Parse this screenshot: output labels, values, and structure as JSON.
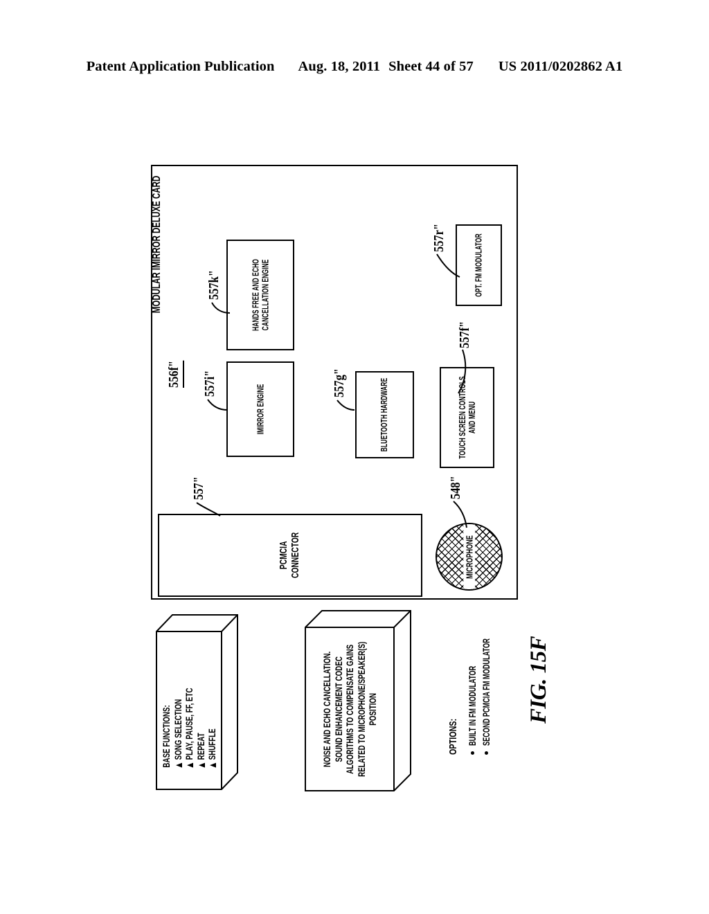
{
  "header": {
    "publication": "Patent Application Publication",
    "date": "Aug. 18, 2011",
    "sheet": "Sheet 44 of 57",
    "number": "US 2011/0202862 A1"
  },
  "figure": {
    "caption": "FIG. 15F",
    "card_title": "MODULAR IMIRROR DELUXE CARD"
  },
  "boxes": {
    "hands_free": {
      "line1": "HANDS FREE AND ECHO",
      "line2": "CANCELLATION ENGINE",
      "ref": "557k\""
    },
    "imirror": {
      "line1": "IMIRROR ENGINE",
      "ref": "557i\""
    },
    "bluetooth": {
      "line1": "BLUETOOTH HARDWARE",
      "ref": "557g\""
    },
    "touch": {
      "line1": "TOUCH SCREEN CONTROLS",
      "line2": "AND MENU",
      "ref": "557f\""
    },
    "fm": {
      "line1": "OPT. FM MODULATOR",
      "ref": "557r\""
    },
    "pcmcia": {
      "line1": "PCMCIA",
      "line2": "CONNECTOR",
      "ref": "557\""
    },
    "microphone": {
      "line1": "MICROPHONE",
      "ref": "548\""
    },
    "card_ref": "556f\""
  },
  "base_functions": {
    "title": "BASE FUNCTIONS:",
    "items": [
      "SONG SELECTION",
      "PLAY, PAUSE, FF, ETC",
      "REPEAT",
      "SHUFFLE"
    ]
  },
  "noise_box": {
    "lines": [
      "NOISE AND ECHO CANCELLATION.",
      "SOUND ENHANCEMENT CODEC",
      "ALGORITHMS TO COMPENSATE GAINS",
      "RELATED TO MICROPHONE/SPEAKER(S)",
      "POSITION"
    ]
  },
  "options": {
    "title": "OPTIONS:",
    "items": [
      "BUILT IN FM MODULATOR",
      "SECOND PCMCIA FM MODULATOR"
    ]
  },
  "colors": {
    "ink": "#000000",
    "paper": "#ffffff"
  }
}
